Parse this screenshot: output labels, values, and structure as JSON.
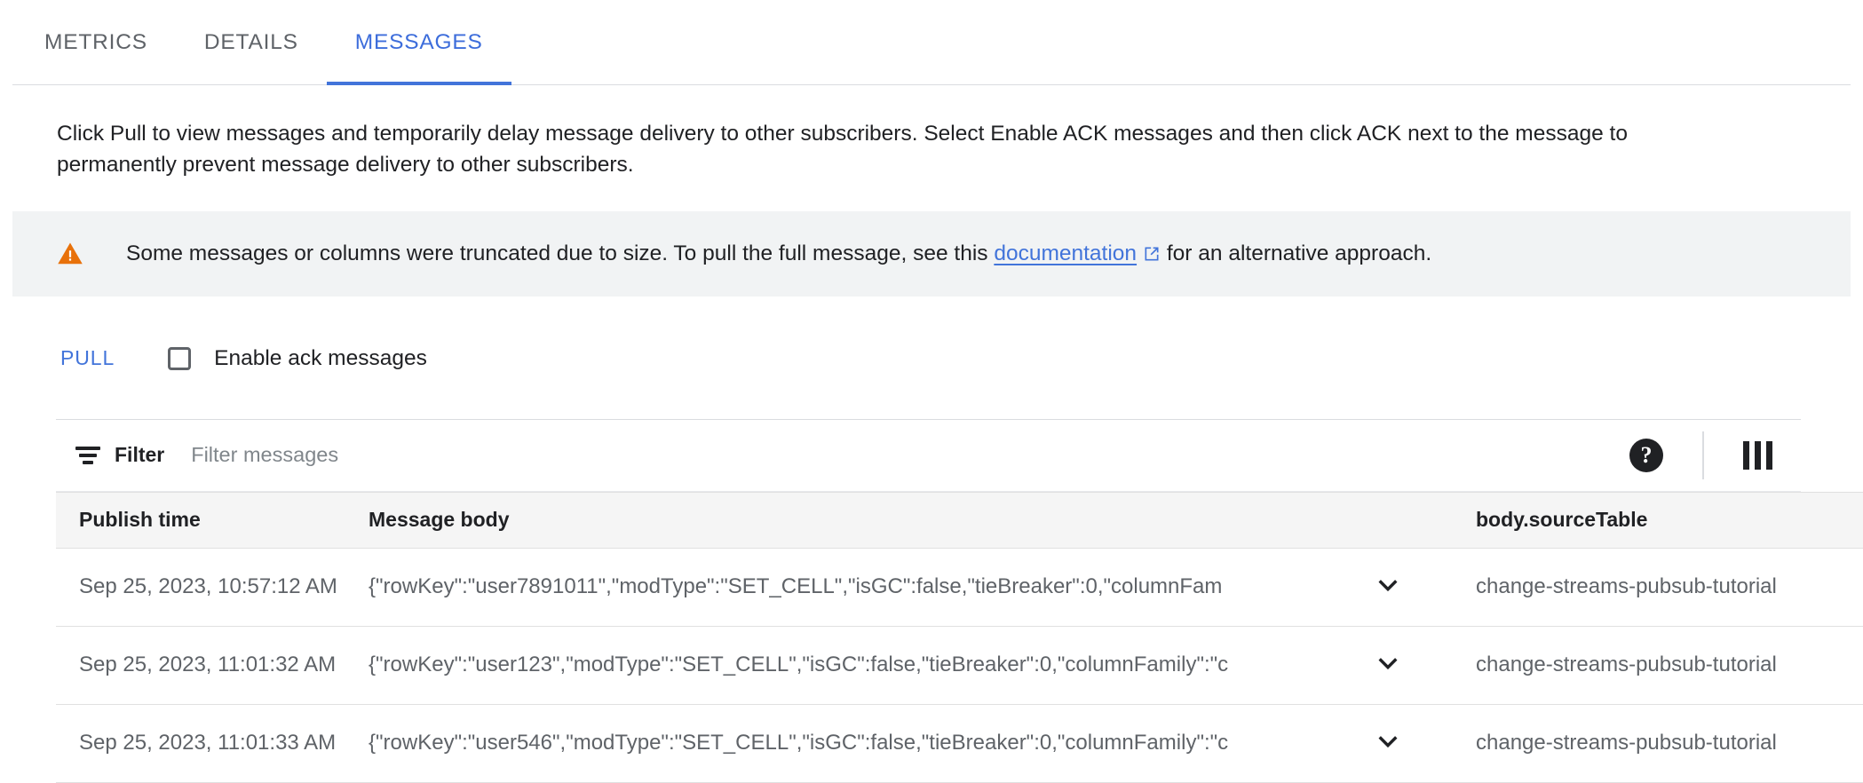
{
  "tabs": [
    {
      "label": "METRICS",
      "active": false
    },
    {
      "label": "DETAILS",
      "active": false
    },
    {
      "label": "MESSAGES",
      "active": true
    }
  ],
  "intro": {
    "text": "Click Pull to view messages and temporarily delay message delivery to other subscribers. Select Enable ACK messages and then click ACK next to the message to permanently prevent message delivery to other subscribers."
  },
  "banner": {
    "icon": "warning-triangle-icon",
    "text_before": "Some messages or columns were truncated due to size. To pull the full message, see this",
    "link_label": "documentation",
    "link_icon": "external-link-icon",
    "text_after": "for an alternative approach.",
    "accent_color": "#e8710a",
    "background": "#f1f3f4"
  },
  "actions": {
    "pull_label": "PULL",
    "ack_label": "Enable ack messages",
    "ack_checked": false,
    "link_color": "#4274da"
  },
  "filter": {
    "icon": "filter-icon",
    "label": "Filter",
    "placeholder": "Filter messages",
    "value": "",
    "help_icon": "help-icon",
    "help_glyph": "?",
    "columns_icon": "column-display-icon"
  },
  "table": {
    "columns": [
      "Publish time",
      "Message body",
      "",
      "body.sourceTable"
    ],
    "rows": [
      {
        "publish_time": "Sep 25, 2023, 10:57:12 AM",
        "message_body": "{\"rowKey\":\"user7891011\",\"modType\":\"SET_CELL\",\"isGC\":false,\"tieBreaker\":0,\"columnFam",
        "expand_icon": "chevron-down-icon",
        "source_table": "change-streams-pubsub-tutorial"
      },
      {
        "publish_time": "Sep 25, 2023, 11:01:32 AM",
        "message_body": "{\"rowKey\":\"user123\",\"modType\":\"SET_CELL\",\"isGC\":false,\"tieBreaker\":0,\"columnFamily\":\"c",
        "expand_icon": "chevron-down-icon",
        "source_table": "change-streams-pubsub-tutorial"
      },
      {
        "publish_time": "Sep 25, 2023, 11:01:33 AM",
        "message_body": "{\"rowKey\":\"user546\",\"modType\":\"SET_CELL\",\"isGC\":false,\"tieBreaker\":0,\"columnFamily\":\"c",
        "expand_icon": "chevron-down-icon",
        "source_table": "change-streams-pubsub-tutorial"
      }
    ]
  }
}
